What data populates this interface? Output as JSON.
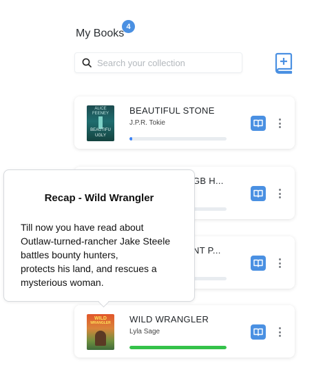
{
  "header": {
    "title": "My Books",
    "count": "4"
  },
  "search": {
    "placeholder": "Search your collection"
  },
  "colors": {
    "accent": "#4a90e2",
    "progress_blue": "#3b82f6",
    "progress_green": "#34c24a"
  },
  "books": [
    {
      "title": "BEAUTIFUL STONE",
      "author": "J.P.R. Tokie",
      "progress": 0.02,
      "cover_text": [
        "ALICE",
        "FEENEY",
        "BEAUTIFU",
        "UGLY"
      ]
    },
    {
      "title": "GB H...",
      "author": "",
      "progress": 0.0
    },
    {
      "title": "NT P...",
      "author": "",
      "progress": 0.0
    },
    {
      "title": "WILD WRANGLER",
      "author": "Lyla Sage",
      "progress": 1.0,
      "cover_text": [
        "WILD",
        "WRANGLER"
      ]
    }
  ],
  "tooltip": {
    "heading": "Recap - Wild Wrangler",
    "lines": [
      "Till now you have read about",
      "Outlaw-turned-rancher Jake Steele",
      "battles bounty hunters,",
      "protects his land, and rescues a",
      "mysterious woman."
    ]
  }
}
